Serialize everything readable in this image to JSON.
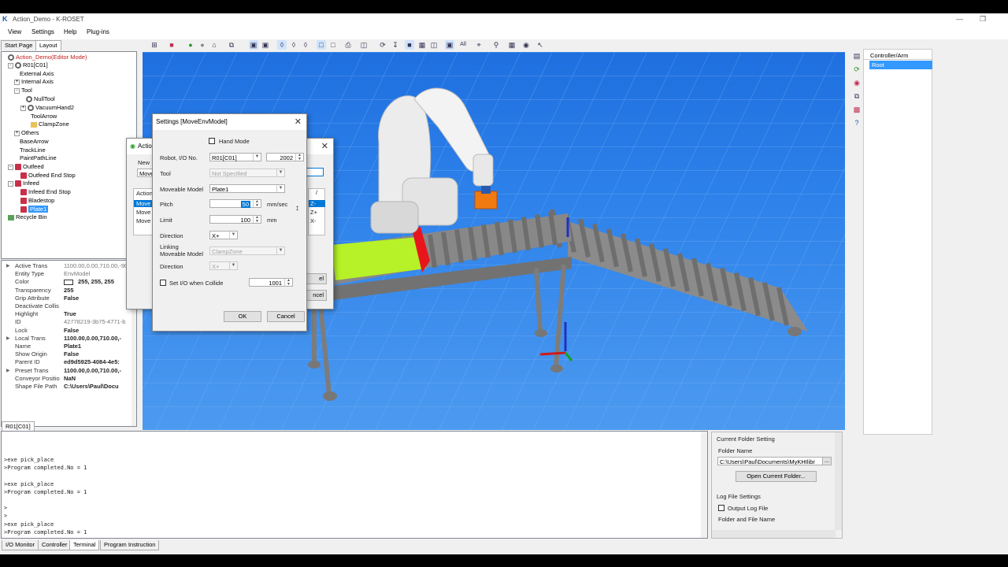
{
  "window": {
    "title": "Action_Demo - K-ROSET",
    "menu": [
      "View",
      "Settings",
      "Help",
      "Plug-ins"
    ],
    "left_tabs": [
      "Start Page",
      "Layout"
    ],
    "toolbar_all": "All"
  },
  "tree": {
    "root": "Action_Demo(Editor Mode)",
    "items": [
      "R01[C01]",
      "External Axis",
      "Internal Axis",
      "Tool",
      "NullTool",
      "VacuumHand2",
      "ToolArrow",
      "ClampZone",
      "Others",
      "BaseArrow",
      "TrackLine",
      "PaintPathLine",
      "Outfeed",
      "Outfeed End Stop",
      "Infeed",
      "Infeed End Stop",
      "Bladestop",
      "Plate1",
      "Recycle Bin"
    ]
  },
  "properties": [
    {
      "k": "Active Trans",
      "v": "1100.00,0.00,710.00,-90.",
      "light": true,
      "arrow": true
    },
    {
      "k": "Entity Type",
      "v": "EnvModel",
      "light": true
    },
    {
      "k": "Color",
      "v": "255, 255, 255",
      "swatch": true
    },
    {
      "k": "Transparency",
      "v": "255"
    },
    {
      "k": "Grip Attribute",
      "v": "False"
    },
    {
      "k": "Deactivate Collis",
      "v": ""
    },
    {
      "k": "Highlight",
      "v": "True"
    },
    {
      "k": "ID",
      "v": "42778219-3b75-4771-b",
      "light": true
    },
    {
      "k": "Lock",
      "v": "False"
    },
    {
      "k": "Local Trans",
      "v": "1100.00,0.00,710.00,-",
      "arrow": true
    },
    {
      "k": "Name",
      "v": "Plate1"
    },
    {
      "k": "Show Origin",
      "v": "False"
    },
    {
      "k": "Parent ID",
      "v": "ed9d5925-4084-4e5:"
    },
    {
      "k": "Preset Trans",
      "v": "1100.00,0.00,710.00,-",
      "arrow": true
    },
    {
      "k": "Conveyor Positio",
      "v": "NaN"
    },
    {
      "k": "Shape File Path",
      "v": "C:\\Users\\Paul\\Docu"
    }
  ],
  "controller": {
    "header": "Controller/Arm",
    "root": "Root"
  },
  "terminal": {
    "tab": "R01[C01]",
    "lines": [
      ">exe pick_place",
      ">Program completed.No = 1",
      "",
      ">exe pick_place",
      ">Program completed.No = 1",
      "",
      ">",
      ">",
      ">exe pick_place",
      ">Program completed.No = 1"
    ]
  },
  "folder": {
    "header": "Current Folder Setting",
    "name_label": "Folder Name",
    "path": "C:\\Users\\Paul\\Documents\\MyKHIlibr",
    "browse": "...",
    "open_button": "Open Current Folder...",
    "log_header": "Log File Settings",
    "output_log": "Output Log File",
    "file_label": "Folder and File Name"
  },
  "bottom_tabs": [
    "I/O Monitor",
    "Controller",
    "Terminal",
    "Program Instruction"
  ],
  "back_dialog": {
    "title": "Actio",
    "new_label": "New",
    "field": "Move",
    "list_header": "Action",
    "list": [
      "Move",
      "Move",
      "Move"
    ],
    "axis_header": "/",
    "axis": [
      "Z-",
      "Z+",
      "X-"
    ],
    "btn1": "el",
    "btn2": "ncel"
  },
  "dialog": {
    "title": "Settings [MoveEnvModel]",
    "hand_mode": "Hand Mode",
    "robot_label": "Robot,  I/O No.",
    "robot_value": "R01[C01]",
    "io_value": "2002",
    "tool_label": "Tool",
    "tool_value": "Not Specified",
    "moveable_label": "Moveable Model",
    "moveable_value": "Plate1",
    "pitch_label": "Pitch",
    "pitch_value": "50",
    "pitch_unit": "mm/sec",
    "limit_label": "Limit",
    "limit_value": "100",
    "limit_unit": "mm",
    "direction_label": "Direction",
    "direction_value": "X+",
    "linking_label1": "Linking",
    "linking_label2": "Moveable Model",
    "linking_value": "ClampZone",
    "direction2_label": "Direction",
    "direction2_value": "X+",
    "set_io_label": "Set I/O when Collide",
    "set_io_value": "1001",
    "ok": "OK",
    "cancel": "Cancel"
  }
}
